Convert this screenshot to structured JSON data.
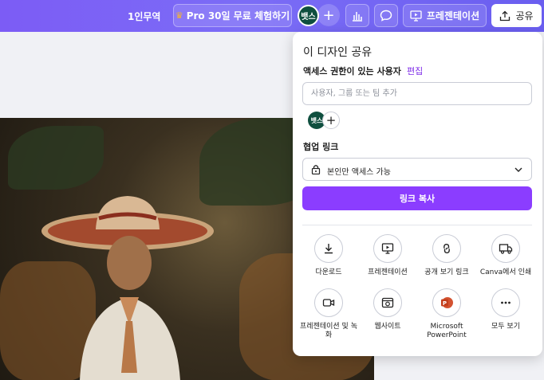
{
  "topbar": {
    "plan_text": "1인무역",
    "pro_button": "Pro 30일 무료 체험하기",
    "avatar_text": "뱃스",
    "present_button": "프레젠테이션",
    "share_button": "공유"
  },
  "share_panel": {
    "title": "이 디자인 공유",
    "access_label": "액세스 권한이 있는 사용자",
    "edit_link": "편집",
    "search_placeholder": "사용자, 그룹 또는 팀 추가",
    "avatar_text": "뱃스",
    "collab_label": "협업 링크",
    "access_option": "본인만 액세스 가능",
    "copy_button": "링크 복사",
    "options": [
      {
        "label": "다운로드",
        "icon": "download-icon"
      },
      {
        "label": "프레젠테이션",
        "icon": "present-icon"
      },
      {
        "label": "공개 보기 링크",
        "icon": "link-icon"
      },
      {
        "label": "Canva에서 인쇄",
        "icon": "truck-icon"
      },
      {
        "label": "프레젠테이션 및 녹화",
        "icon": "camera-icon"
      },
      {
        "label": "웹사이트",
        "icon": "website-icon"
      },
      {
        "label": "Microsoft PowerPoint",
        "icon": "powerpoint-icon"
      },
      {
        "label": "모두 보기",
        "icon": "more-icon"
      }
    ]
  },
  "colors": {
    "brand_purple": "#8b3dff",
    "topbar": "#7c5cf5",
    "avatar_green": "#0f4f3f"
  }
}
